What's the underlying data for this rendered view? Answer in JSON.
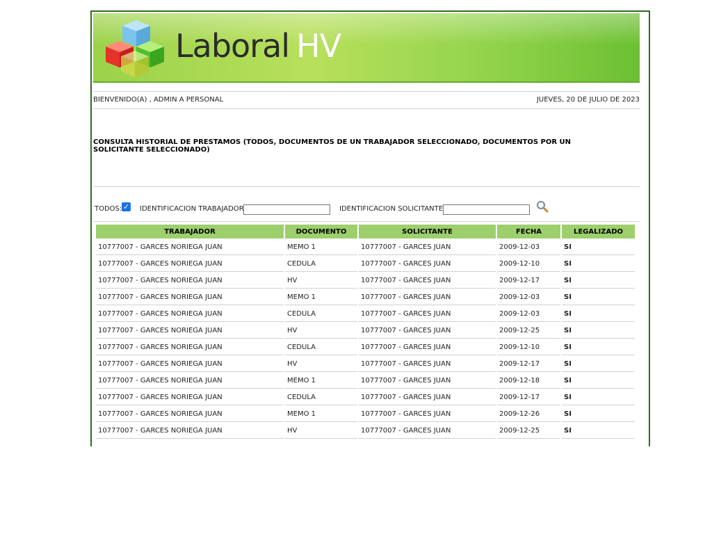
{
  "header": {
    "logo_word": "Laboral",
    "logo_accent": "HV"
  },
  "welcome": {
    "greeting": "BIENVENIDO(A) , ADMIN A PERSONAL",
    "date": "JUEVES, 20 DE JULIO DE 2023"
  },
  "page_title": "CONSULTA HISTORIAL DE PRESTAMOS (TODOS, DOCUMENTOS DE UN TRABAJADOR SELECCIONADO, DOCUMENTOS POR UN SOLICITANTE SELECCIONADO)",
  "filters": {
    "todos_label": "TODOS:",
    "todos_checked": true,
    "worker_id_label": "IDENTIFICACION TRABAJADOR:",
    "worker_id_value": "",
    "requester_id_label": "IDENTIFICACION SOLICITANTE:",
    "requester_id_value": "",
    "search_icon": "magnifier-icon"
  },
  "table": {
    "columns": [
      "TRABAJADOR",
      "DOCUMENTO",
      "SOLICITANTE",
      "FECHA",
      "LEGALIZADO"
    ],
    "rows": [
      [
        "10777007 - GARCES NORIEGA JUAN",
        "MEMO 1",
        "10777007 - GARCES JUAN",
        "2009-12-03",
        "SI"
      ],
      [
        "10777007 - GARCES NORIEGA JUAN",
        "CEDULA",
        "10777007 - GARCES JUAN",
        "2009-12-10",
        "SI"
      ],
      [
        "10777007 - GARCES NORIEGA JUAN",
        "HV",
        "10777007 - GARCES JUAN",
        "2009-12-17",
        "SI"
      ],
      [
        "10777007 - GARCES NORIEGA JUAN",
        "MEMO 1",
        "10777007 - GARCES JUAN",
        "2009-12-03",
        "SI"
      ],
      [
        "10777007 - GARCES NORIEGA JUAN",
        "CEDULA",
        "10777007 - GARCES JUAN",
        "2009-12-03",
        "SI"
      ],
      [
        "10777007 - GARCES NORIEGA JUAN",
        "HV",
        "10777007 - GARCES JUAN",
        "2009-12-25",
        "SI"
      ],
      [
        "10777007 - GARCES NORIEGA JUAN",
        "CEDULA",
        "10777007 - GARCES JUAN",
        "2009-12-10",
        "SI"
      ],
      [
        "10777007 - GARCES NORIEGA JUAN",
        "HV",
        "10777007 - GARCES JUAN",
        "2009-12-17",
        "SI"
      ],
      [
        "10777007 - GARCES NORIEGA JUAN",
        "MEMO 1",
        "10777007 - GARCES JUAN",
        "2009-12-18",
        "SI"
      ],
      [
        "10777007 - GARCES NORIEGA JUAN",
        "CEDULA",
        "10777007 - GARCES JUAN",
        "2009-12-17",
        "SI"
      ],
      [
        "10777007 - GARCES NORIEGA JUAN",
        "MEMO 1",
        "10777007 - GARCES JUAN",
        "2009-12-26",
        "SI"
      ],
      [
        "10777007 - GARCES NORIEGA JUAN",
        "HV",
        "10777007 - GARCES JUAN",
        "2009-12-25",
        "SI"
      ]
    ]
  },
  "colors": {
    "frame_border": "#2e6b1f",
    "header_cell": "#9dcf6c",
    "checkbox": "#1a73e8"
  }
}
